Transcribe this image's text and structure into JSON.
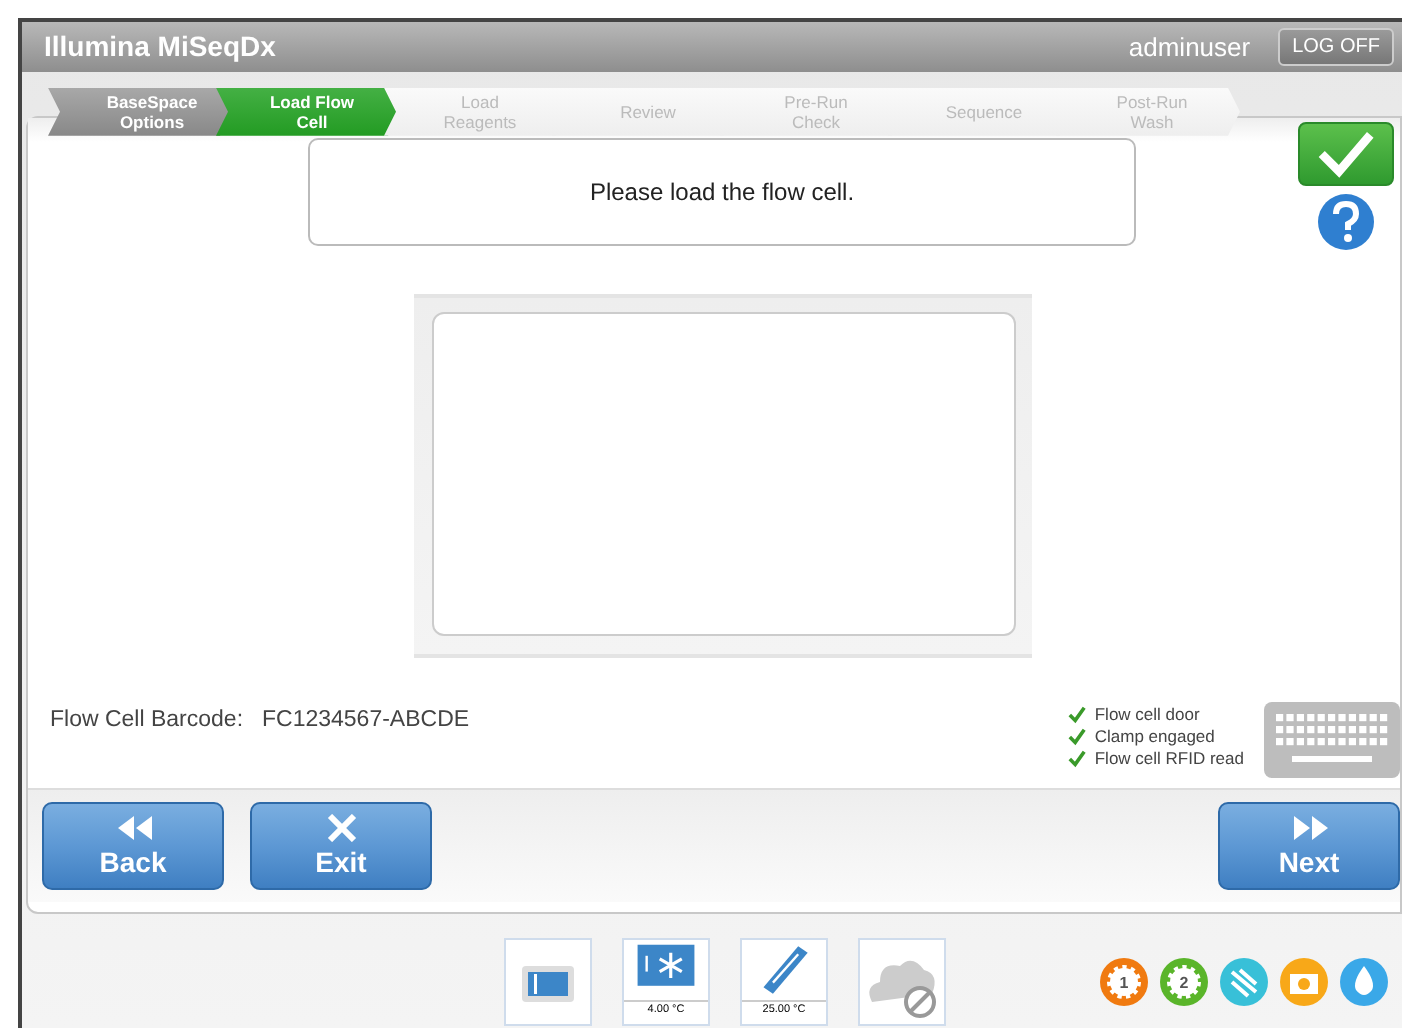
{
  "header": {
    "title": "Illumina MiSeqDx",
    "user": "adminuser",
    "logoff": "LOG OFF"
  },
  "steps": [
    {
      "label": "BaseSpace Options",
      "selected": false,
      "completed": true
    },
    {
      "label": "Load Flow Cell",
      "selected": true,
      "completed": false
    },
    {
      "label": "Load Reagents",
      "selected": false,
      "completed": false
    },
    {
      "label": "Review",
      "selected": false,
      "completed": false
    },
    {
      "label": "Pre-Run Check",
      "selected": false,
      "completed": false
    },
    {
      "label": "Sequence",
      "selected": false,
      "completed": false
    },
    {
      "label": "Post-Run Wash",
      "selected": false,
      "completed": false
    }
  ],
  "message": "Please load the flow cell.",
  "barcode": {
    "label": "Flow Cell Barcode:",
    "value": "FC1234567-ABCDE"
  },
  "checks": [
    {
      "label": "Flow cell door",
      "checked": true
    },
    {
      "label": "Clamp engaged",
      "checked": true
    },
    {
      "label": "Flow cell RFID read",
      "checked": true
    }
  ],
  "nav": [
    {
      "label": "Back",
      "kind": "back"
    },
    {
      "label": "Exit",
      "kind": "exit"
    },
    {
      "label": "Next",
      "kind": "next"
    }
  ],
  "tray": [
    {
      "kind": "flowcell"
    },
    {
      "kind": "chiller",
      "reading": "4.00 °C"
    },
    {
      "kind": "reagent",
      "reading": "25.00 °C"
    },
    {
      "kind": "cloud"
    }
  ],
  "indicators": [
    {
      "kind": "gear",
      "label": "1",
      "color": "#f07a10"
    },
    {
      "kind": "gear",
      "label": "2",
      "color": "#5ab52a"
    },
    {
      "kind": "network",
      "color": "#38c0d8"
    },
    {
      "kind": "camera",
      "color": "#f8a818"
    },
    {
      "kind": "drop",
      "color": "#3aa8e8"
    }
  ]
}
